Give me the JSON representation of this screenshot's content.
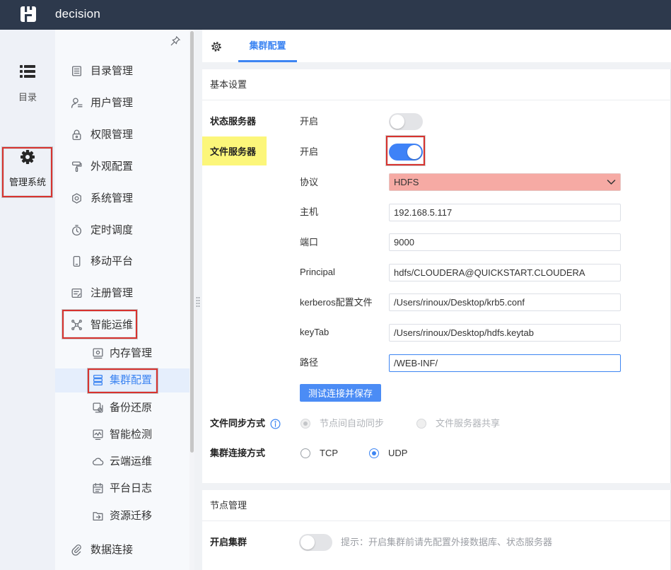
{
  "app": {
    "title": "decision",
    "logo_icon": "logo-icon"
  },
  "colors": {
    "header_bg": "#2d394c",
    "accent": "#3d85f2",
    "annotation_red": "#d8332f",
    "highlight_yellow": "#fcf67a",
    "select_highlight": "#f6aaa4"
  },
  "nav_primary": {
    "directory": {
      "label": "目录",
      "icon": "list-icon"
    },
    "management": {
      "label": "管理系统",
      "icon": "gear-icon",
      "active": true
    }
  },
  "nav_secondary": {
    "pin_icon": "pin-icon",
    "items": [
      {
        "label": "目录管理",
        "icon": "directory-icon"
      },
      {
        "label": "用户管理",
        "icon": "user-icon"
      },
      {
        "label": "权限管理",
        "icon": "lock-icon"
      },
      {
        "label": "外观配置",
        "icon": "paint-roller-icon"
      },
      {
        "label": "系统管理",
        "icon": "settings-icon"
      },
      {
        "label": "定时调度",
        "icon": "timer-icon"
      },
      {
        "label": "移动平台",
        "icon": "mobile-icon"
      },
      {
        "label": "注册管理",
        "icon": "register-icon"
      },
      {
        "label": "智能运维",
        "icon": "network-icon",
        "expanded": true
      }
    ],
    "sub_items": [
      {
        "label": "内存管理",
        "icon": "memory-icon"
      },
      {
        "label": "集群配置",
        "icon": "cluster-icon",
        "active": true
      },
      {
        "label": "备份还原",
        "icon": "backup-icon"
      },
      {
        "label": "智能检测",
        "icon": "detection-icon"
      },
      {
        "label": "云端运维",
        "icon": "cloud-icon"
      },
      {
        "label": "平台日志",
        "icon": "log-icon"
      },
      {
        "label": "资源迁移",
        "icon": "migrate-icon"
      }
    ],
    "bottom_item": {
      "label": "数据连接",
      "icon": "link-icon"
    }
  },
  "tabs": {
    "settings_icon": "gear-icon",
    "items": [
      {
        "label": "集群配置",
        "active": true
      }
    ]
  },
  "basic_settings": {
    "title": "基本设置",
    "status_server": {
      "label": "状态服务器",
      "toggle_label": "开启",
      "enabled": false
    },
    "file_server": {
      "label": "文件服务器",
      "toggle_label": "开启",
      "enabled": true
    },
    "fields": {
      "protocol": {
        "label": "协议",
        "value": "HDFS"
      },
      "host": {
        "label": "主机",
        "value": "192.168.5.117"
      },
      "port": {
        "label": "端口",
        "value": "9000"
      },
      "principal": {
        "label": "Principal",
        "value": "hdfs/CLOUDERA@QUICKSTART.CLOUDERA"
      },
      "kerberos_file": {
        "label": "kerberos配置文件",
        "value": "/Users/rinoux/Desktop/krb5.conf"
      },
      "keytab": {
        "label": "keyTab",
        "value": "/Users/rinoux/Desktop/hdfs.keytab"
      },
      "path": {
        "label": "路径",
        "value": "/WEB-INF/"
      }
    },
    "save_button": "测试连接并保存",
    "file_sync": {
      "label": "文件同步方式",
      "info_icon": "info-icon",
      "disabled": true,
      "options": [
        {
          "label": "节点间自动同步",
          "selected": true
        },
        {
          "label": "文件服务器共享",
          "selected": false
        }
      ]
    },
    "cluster_connection": {
      "label": "集群连接方式",
      "options": [
        {
          "label": "TCP",
          "selected": false
        },
        {
          "label": "UDP",
          "selected": true
        }
      ]
    }
  },
  "node_management": {
    "title": "节点管理",
    "enable_cluster": {
      "label": "开启集群",
      "enabled": false,
      "hint": "提示：开启集群前请先配置外接数据库、状态服务器"
    }
  }
}
